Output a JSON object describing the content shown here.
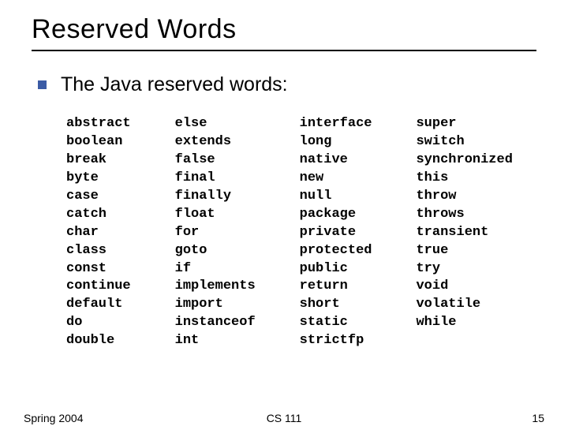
{
  "title": "Reserved Words",
  "bullet": "The Java reserved words:",
  "columns": [
    [
      "abstract",
      "boolean",
      "break",
      "byte",
      "case",
      "catch",
      "char",
      "class",
      "const",
      "continue",
      "default",
      "do",
      "double"
    ],
    [
      "else",
      "extends",
      "false",
      "final",
      "finally",
      "float",
      "for",
      "goto",
      "if",
      "implements",
      "import",
      "instanceof",
      "int"
    ],
    [
      "interface",
      "long",
      "native",
      "new",
      "null",
      "package",
      "private",
      "protected",
      "public",
      "return",
      "short",
      "static",
      "strictfp"
    ],
    [
      "super",
      "switch",
      "synchronized",
      "this",
      "throw",
      "throws",
      "transient",
      "true",
      "try",
      "void",
      "volatile",
      "while"
    ]
  ],
  "footer": {
    "left": "Spring 2004",
    "center": "CS 111",
    "right": "15"
  }
}
